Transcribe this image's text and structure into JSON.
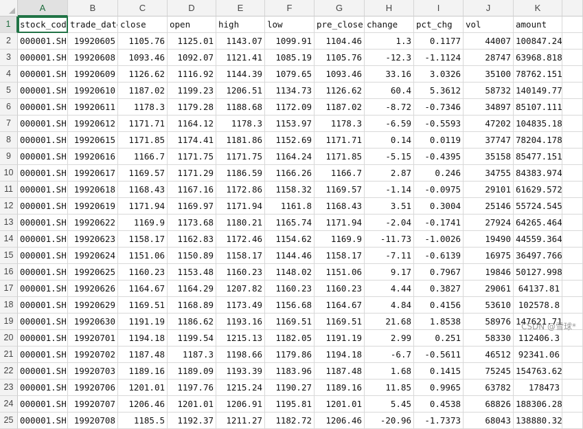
{
  "column_letters": [
    "A",
    "B",
    "C",
    "D",
    "E",
    "F",
    "G",
    "H",
    "I",
    "J",
    "K"
  ],
  "active_column": "A",
  "active_row": 1,
  "headers": [
    "stock_code",
    "trade_date",
    "close",
    "open",
    "high",
    "low",
    "pre_close",
    "change",
    "pct_chg",
    "vol",
    "amount"
  ],
  "rows": [
    [
      "000001.SH",
      "19920605",
      "1105.76",
      "1125.01",
      "1143.07",
      "1099.91",
      "1104.46",
      "1.3",
      "0.1177",
      "44007",
      "100847.24"
    ],
    [
      "000001.SH",
      "19920608",
      "1093.46",
      "1092.07",
      "1121.41",
      "1085.19",
      "1105.76",
      "-12.3",
      "-1.1124",
      "28747",
      "63968.818"
    ],
    [
      "000001.SH",
      "19920609",
      "1126.62",
      "1116.92",
      "1144.39",
      "1079.65",
      "1093.46",
      "33.16",
      "3.0326",
      "35100",
      "78762.151"
    ],
    [
      "000001.SH",
      "19920610",
      "1187.02",
      "1199.23",
      "1206.51",
      "1134.73",
      "1126.62",
      "60.4",
      "5.3612",
      "58732",
      "140149.77"
    ],
    [
      "000001.SH",
      "19920611",
      "1178.3",
      "1179.28",
      "1188.68",
      "1172.09",
      "1187.02",
      "-8.72",
      "-0.7346",
      "34897",
      "85107.111"
    ],
    [
      "000001.SH",
      "19920612",
      "1171.71",
      "1164.12",
      "1178.3",
      "1153.97",
      "1178.3",
      "-6.59",
      "-0.5593",
      "47202",
      "104835.18"
    ],
    [
      "000001.SH",
      "19920615",
      "1171.85",
      "1174.41",
      "1181.86",
      "1152.69",
      "1171.71",
      "0.14",
      "0.0119",
      "37747",
      "78204.178"
    ],
    [
      "000001.SH",
      "19920616",
      "1166.7",
      "1171.75",
      "1171.75",
      "1164.24",
      "1171.85",
      "-5.15",
      "-0.4395",
      "35158",
      "85477.151"
    ],
    [
      "000001.SH",
      "19920617",
      "1169.57",
      "1171.29",
      "1186.59",
      "1166.26",
      "1166.7",
      "2.87",
      "0.246",
      "34755",
      "84383.974"
    ],
    [
      "000001.SH",
      "19920618",
      "1168.43",
      "1167.16",
      "1172.86",
      "1158.32",
      "1169.57",
      "-1.14",
      "-0.0975",
      "29101",
      "61629.572"
    ],
    [
      "000001.SH",
      "19920619",
      "1171.94",
      "1169.97",
      "1171.94",
      "1161.8",
      "1168.43",
      "3.51",
      "0.3004",
      "25146",
      "55724.545"
    ],
    [
      "000001.SH",
      "19920622",
      "1169.9",
      "1173.68",
      "1180.21",
      "1165.74",
      "1171.94",
      "-2.04",
      "-0.1741",
      "27924",
      "64265.464"
    ],
    [
      "000001.SH",
      "19920623",
      "1158.17",
      "1162.83",
      "1172.46",
      "1154.62",
      "1169.9",
      "-11.73",
      "-1.0026",
      "19490",
      "44559.364"
    ],
    [
      "000001.SH",
      "19920624",
      "1151.06",
      "1150.89",
      "1158.17",
      "1144.46",
      "1158.17",
      "-7.11",
      "-0.6139",
      "16975",
      "36497.766"
    ],
    [
      "000001.SH",
      "19920625",
      "1160.23",
      "1153.48",
      "1160.23",
      "1148.02",
      "1151.06",
      "9.17",
      "0.7967",
      "19846",
      "50127.998"
    ],
    [
      "000001.SH",
      "19920626",
      "1164.67",
      "1164.29",
      "1207.82",
      "1160.23",
      "1160.23",
      "4.44",
      "0.3827",
      "29061",
      "64137.81"
    ],
    [
      "000001.SH",
      "19920629",
      "1169.51",
      "1168.89",
      "1173.49",
      "1156.68",
      "1164.67",
      "4.84",
      "0.4156",
      "53610",
      "102578.8"
    ],
    [
      "000001.SH",
      "19920630",
      "1191.19",
      "1186.62",
      "1193.16",
      "1169.51",
      "1169.51",
      "21.68",
      "1.8538",
      "58976",
      "147621.71"
    ],
    [
      "000001.SH",
      "19920701",
      "1194.18",
      "1199.54",
      "1215.13",
      "1182.05",
      "1191.19",
      "2.99",
      "0.251",
      "58330",
      "112406.3"
    ],
    [
      "000001.SH",
      "19920702",
      "1187.48",
      "1187.3",
      "1198.66",
      "1179.86",
      "1194.18",
      "-6.7",
      "-0.5611",
      "46512",
      "92341.06"
    ],
    [
      "000001.SH",
      "19920703",
      "1189.16",
      "1189.09",
      "1193.39",
      "1183.96",
      "1187.48",
      "1.68",
      "0.1415",
      "75245",
      "154763.62"
    ],
    [
      "000001.SH",
      "19920706",
      "1201.01",
      "1197.76",
      "1215.24",
      "1190.27",
      "1189.16",
      "11.85",
      "0.9965",
      "63782",
      "178473"
    ],
    [
      "000001.SH",
      "19920707",
      "1206.46",
      "1201.01",
      "1206.91",
      "1195.81",
      "1201.01",
      "5.45",
      "0.4538",
      "68826",
      "188306.282"
    ],
    [
      "000001.SH",
      "19920708",
      "1185.5",
      "1192.37",
      "1211.27",
      "1182.72",
      "1206.46",
      "-20.96",
      "-1.7373",
      "68043",
      "138880.32"
    ]
  ],
  "watermark": "CSDN @雪球*"
}
